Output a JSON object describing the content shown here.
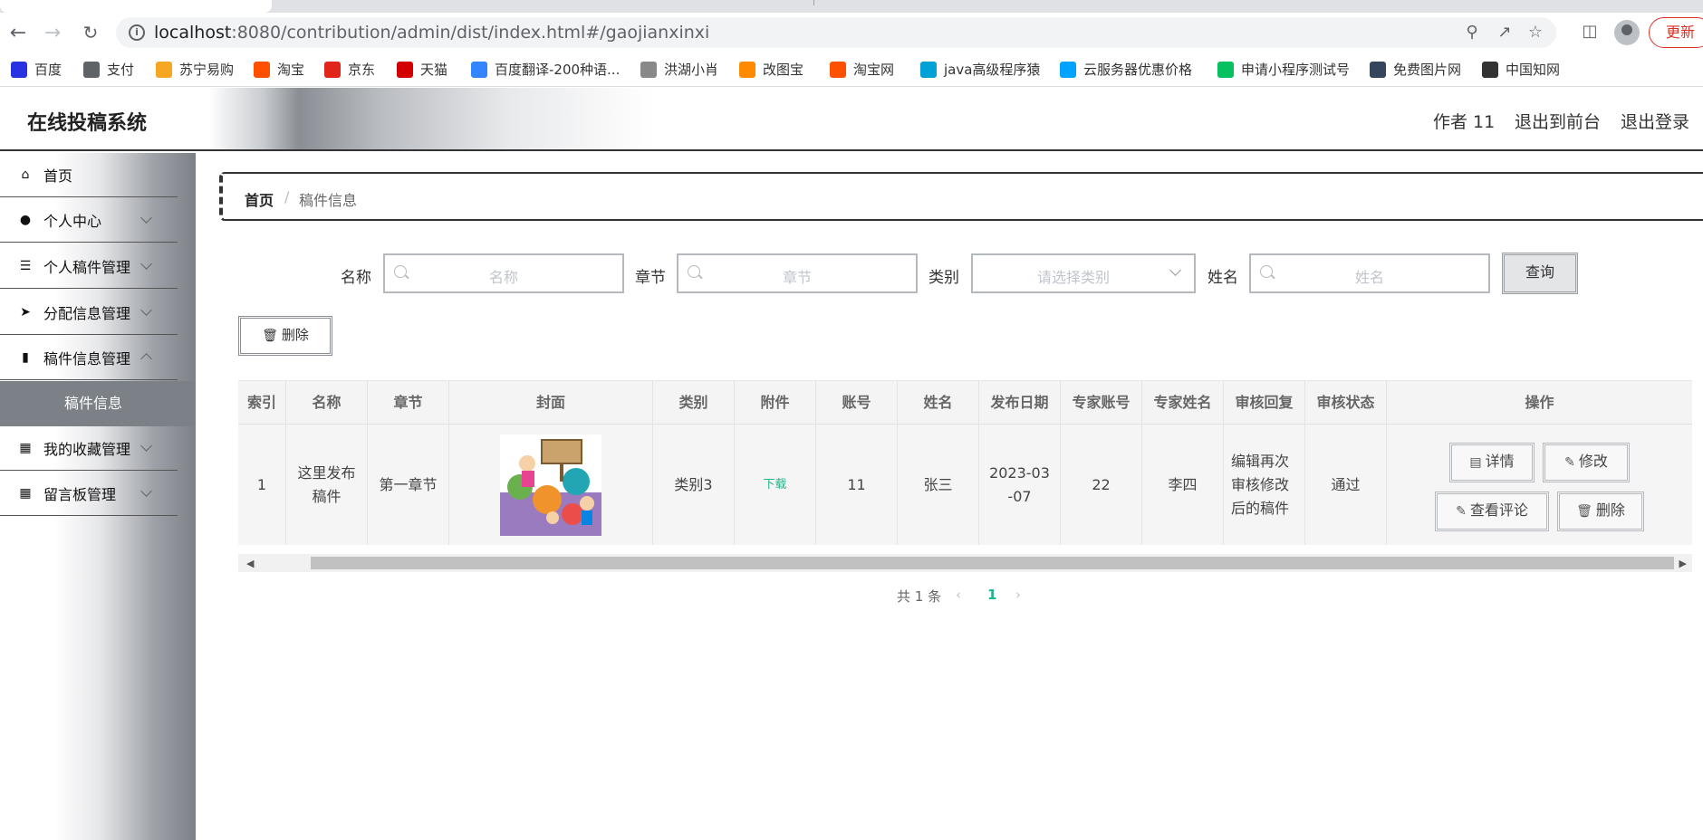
{
  "browser": {
    "url_host": "localhost",
    "url_path": ":8080/contribution/admin/dist/index.html#/gaojianxinxi",
    "update_label": "更新",
    "bookmarks": [
      {
        "label": "百度",
        "icon": "baidu-icon",
        "color": "#2932e1"
      },
      {
        "label": "支付",
        "icon": "globe-icon",
        "color": "#5f6368"
      },
      {
        "label": "苏宁易购",
        "icon": "suning-icon",
        "color": "#f5a623"
      },
      {
        "label": "淘宝",
        "icon": "taobao-icon",
        "color": "#ff5000"
      },
      {
        "label": "京东",
        "icon": "jd-icon",
        "color": "#e1251b"
      },
      {
        "label": "天猫",
        "icon": "tmall-icon",
        "color": "#d20000"
      },
      {
        "label": "百度翻译-200种语...",
        "icon": "translate-icon",
        "color": "#3385ff"
      },
      {
        "label": "洪湖小肖",
        "icon": "bird-icon",
        "color": "#888888"
      },
      {
        "label": "改图宝",
        "icon": "gaitubao-icon",
        "color": "#ff8a00"
      },
      {
        "label": "淘宝网",
        "icon": "taobao-icon",
        "color": "#ff5000"
      },
      {
        "label": "java高级程序猿",
        "icon": "bilibili-icon",
        "color": "#00a1d6"
      },
      {
        "label": "云服务器优惠价格",
        "icon": "cloud-icon",
        "color": "#00a3ff"
      },
      {
        "label": "申请小程序测试号",
        "icon": "wechat-icon",
        "color": "#07c160"
      },
      {
        "label": "免费图片网",
        "icon": "tumblr-icon",
        "color": "#35465c"
      },
      {
        "label": "中国知网",
        "icon": "cnki-icon",
        "color": "#333333"
      }
    ]
  },
  "header": {
    "title": "在线投稿系统",
    "user": "作者 11",
    "to_front": "退出到前台",
    "logout": "退出登录"
  },
  "sidebar": {
    "items": [
      {
        "label": "首页",
        "icon": "home-icon"
      },
      {
        "label": "个人中心",
        "icon": "user-icon"
      },
      {
        "label": "个人稿件管理",
        "icon": "list-icon"
      },
      {
        "label": "分配信息管理",
        "icon": "send-icon"
      },
      {
        "label": "稿件信息管理",
        "icon": "book-icon"
      },
      {
        "label": "我的收藏管理",
        "icon": "grid-icon"
      },
      {
        "label": "留言板管理",
        "icon": "grid-icon"
      }
    ],
    "active_sub": "稿件信息"
  },
  "breadcrumb": {
    "home": "首页",
    "sep": "/",
    "current": "稿件信息"
  },
  "search": {
    "name_label": "名称",
    "name_placeholder": "名称",
    "chapter_label": "章节",
    "chapter_placeholder": "章节",
    "category_label": "类别",
    "category_placeholder": "请选择类别",
    "person_label": "姓名",
    "person_placeholder": "姓名",
    "query_label": "查询"
  },
  "actions": {
    "delete_label": "删除"
  },
  "table": {
    "columns": [
      "索引",
      "名称",
      "章节",
      "封面",
      "类别",
      "附件",
      "账号",
      "姓名",
      "发布日期",
      "专家账号",
      "专家姓名",
      "审核回复",
      "审核状态",
      "操作"
    ],
    "rows": [
      {
        "index": "1",
        "name": "这里发布稿件",
        "chapter": "第一章节",
        "category": "类别3",
        "attachment": "下载",
        "account": "11",
        "person": "张三",
        "date": "2023-03-07",
        "expert_account": "22",
        "expert_name": "李四",
        "reply": "编辑再次审核修改后的稿件",
        "status": "通过",
        "btn_detail": "详情",
        "btn_edit": "修改",
        "btn_comments": "查看评论",
        "btn_delete": "删除"
      }
    ]
  },
  "pager": {
    "total": "共 1 条",
    "current_page": "1"
  },
  "colors": {
    "accent": "#1fb58a",
    "sidebar_active": "#7c8188"
  }
}
